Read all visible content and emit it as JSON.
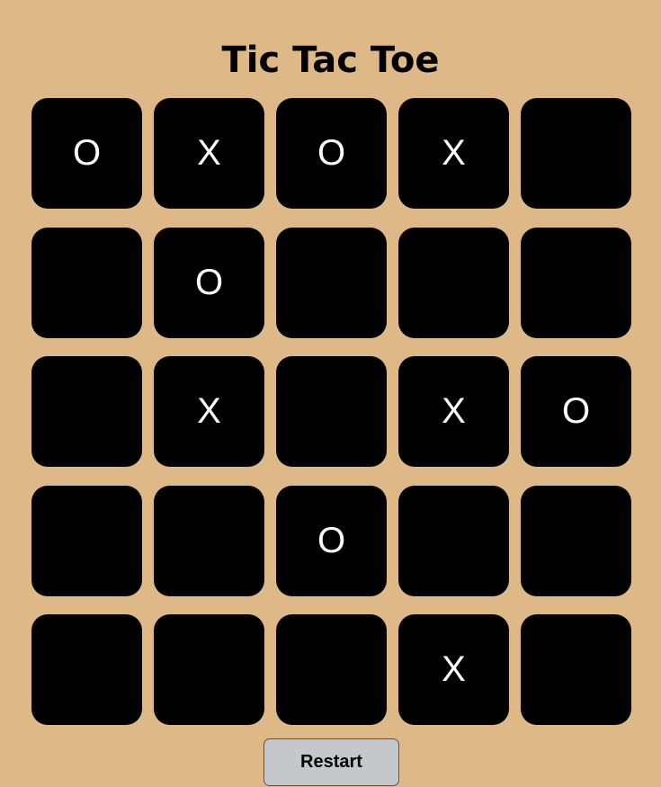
{
  "title": "Tic Tac Toe",
  "board": {
    "rows": [
      [
        "O",
        "X",
        "O",
        "X",
        ""
      ],
      [
        "",
        "O",
        "",
        "",
        ""
      ],
      [
        "",
        "X",
        "",
        "X",
        "O"
      ],
      [
        "",
        "",
        "O",
        "",
        ""
      ],
      [
        "",
        "",
        "",
        "X",
        ""
      ]
    ]
  },
  "restart_label": "Restart",
  "colors": {
    "background": "#deb887",
    "cell": "#000000",
    "mark": "#ffffff",
    "button": "#c4c8cb"
  }
}
